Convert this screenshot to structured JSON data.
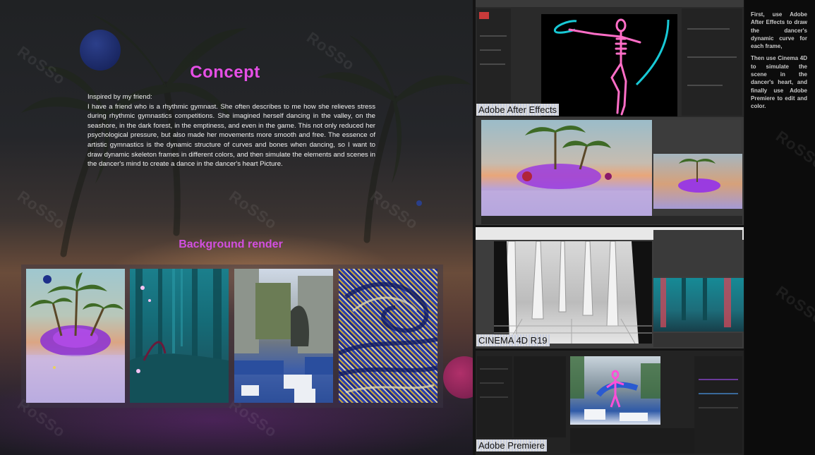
{
  "concept": {
    "title": "Concept",
    "intro": "Inspired by my friend:",
    "body": "I have a friend who is a rhythmic gymnast. She often describes to me how she relieves stress during rhythmic gymnastics competitions. She imagined herself dancing in the valley, on the seashore, in the dark forest, in the emptiness, and even in the game. This not only reduced her psychological pressure, but also made her movements more smooth and free. The essence of artistic gymnastics is the dynamic structure of curves and bones when dancing, so I want to draw dynamic skeleton frames in different colors, and then simulate the elements and scenes in the dancer's mind to create a dance in the dancer's heart Picture."
  },
  "background_render": {
    "title": "Background render",
    "thumbnails": [
      {
        "name": "palm-island-render"
      },
      {
        "name": "dark-forest-render"
      },
      {
        "name": "game-world-render"
      },
      {
        "name": "swirl-pattern-render"
      }
    ]
  },
  "screenshots": {
    "after_effects_label": "Adobe After Effects",
    "cinema4d_label": "CINEMA 4D R19",
    "premiere_label": "Adobe Premiere"
  },
  "description": {
    "para1": "First, use Adobe After Effects to draw the dancer's dynamic curve for each frame,",
    "para2": "Then use Cinema 4D to simulate the scene in the dancer's heart, and finally use Adobe Premiere to edit and color."
  },
  "watermark": "RoSSo",
  "colors": {
    "accent_pink": "#e64fe6",
    "accent_purple": "#d24fe0",
    "skeleton_pink": "#ff6ec7",
    "curve_cyan": "#18c9d6"
  }
}
